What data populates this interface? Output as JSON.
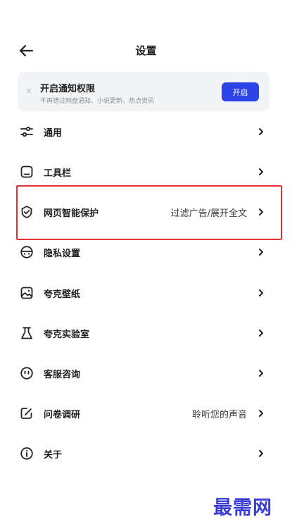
{
  "header": {
    "title": "设置"
  },
  "notice": {
    "title": "开启通知权限",
    "subtitle": "不再错过网盘通知、小说更新、热点资讯",
    "button": "开启",
    "close": "×"
  },
  "settings": [
    {
      "label": "通用",
      "value": "",
      "icon": "sliders-icon"
    },
    {
      "label": "工具栏",
      "value": "",
      "icon": "toolbar-icon"
    },
    {
      "label": "网页智能保护",
      "value": "过滤广告/展开全文",
      "icon": "shield-check-icon"
    },
    {
      "label": "隐私设置",
      "value": "",
      "icon": "privacy-icon"
    },
    {
      "label": "夸克壁纸",
      "value": "",
      "icon": "wallpaper-icon"
    },
    {
      "label": "夸克实验室",
      "value": "",
      "icon": "flask-icon"
    },
    {
      "label": "客服咨询",
      "value": "",
      "icon": "support-icon"
    },
    {
      "label": "问卷调研",
      "value": "聆听您的声音",
      "icon": "survey-icon"
    },
    {
      "label": "关于",
      "value": "",
      "icon": "info-icon"
    }
  ],
  "watermark": "最需网",
  "colors": {
    "accent": "#2d44e6",
    "highlight": "#e5333a",
    "watermark": "#3b3bd8"
  }
}
